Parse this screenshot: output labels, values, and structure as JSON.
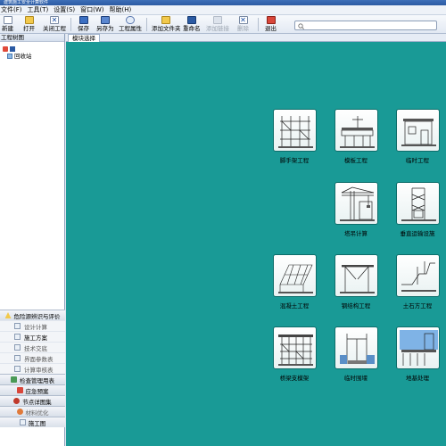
{
  "window": {
    "title": "建筑施工安全计算软件"
  },
  "menu": [
    "文件(F)",
    "工具(T)",
    "设置(S)",
    "窗口(W)",
    "帮助(H)"
  ],
  "toolbar": {
    "new": "新建",
    "open": "打开",
    "close_project": "关闭工程",
    "save": "保存",
    "save_as": "另存为",
    "project_props": "工程属性",
    "add_folder": "添加文件夹",
    "rename": "重命名",
    "add_link": "添加链接",
    "delete": "删除",
    "exit": "退出"
  },
  "search": {
    "placeholder": ""
  },
  "left_panel": {
    "header": "工程树图",
    "tree": [
      {
        "label": ""
      },
      {
        "label": "回收站"
      }
    ]
  },
  "nav": {
    "section1": "危险源辨识与评价",
    "items1": [
      "设计计算",
      "施工方案",
      "技术交底",
      "界面参数表",
      "计算审核表"
    ],
    "section2": "检查管理用表",
    "section3": "应急预案",
    "section4": "节点详图集",
    "section5": "材料优化",
    "section6": "施工图"
  },
  "main": {
    "tab": "模块选择",
    "modules": [
      {
        "label": "脚手架工程",
        "icon": "scaffold-icon"
      },
      {
        "label": "模板工程",
        "icon": "formwork-icon"
      },
      {
        "label": "临时工程",
        "icon": "temporary-icon"
      },
      {
        "label": "塔吊计算",
        "icon": "tower-crane-icon"
      },
      {
        "label": "垂直运输设施",
        "icon": "vertical-transport-icon"
      },
      {
        "label": "混凝土工程",
        "icon": "concrete-icon"
      },
      {
        "label": "钢结构工程",
        "icon": "steel-icon"
      },
      {
        "label": "土石方工程",
        "icon": "earthwork-icon"
      },
      {
        "label": "桥梁支模架",
        "icon": "bridge-formwork-icon"
      },
      {
        "label": "临时围堰",
        "icon": "cofferdam-icon"
      },
      {
        "label": "地基处理",
        "icon": "foundation-icon"
      }
    ]
  },
  "colors": {
    "workspace": "#199a96",
    "accent": "#2b5aa3"
  }
}
